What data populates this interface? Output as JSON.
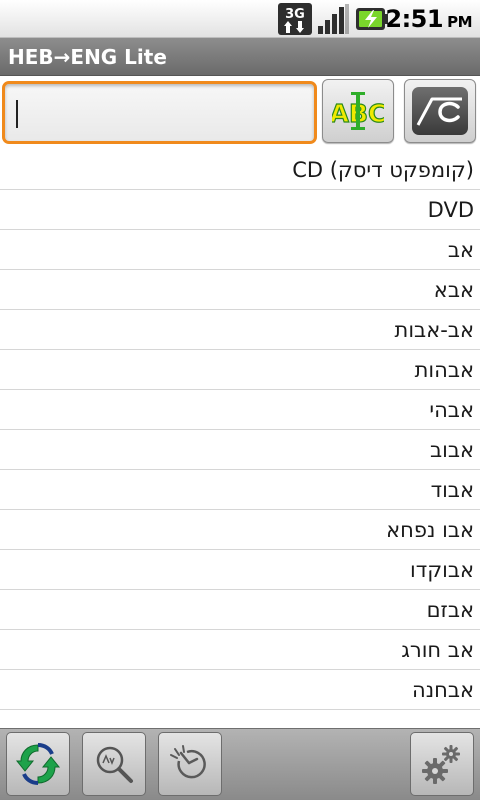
{
  "status_bar": {
    "network": "3G",
    "time": "2:51",
    "ampm": "PM"
  },
  "title_bar": {
    "title": "HEB→ENG Lite"
  },
  "search": {
    "value": "",
    "abc_label": "ABC"
  },
  "list": {
    "items": [
      "CD (קומפקט דיסק)",
      "DVD",
      "אב",
      "אבא",
      "אב-אבות",
      "אבהות",
      "אבהי",
      "אבוב",
      "אבוד",
      "אבו נפחא",
      "אבוקדו",
      "אבזם",
      "אב חורג",
      "אבחנה"
    ]
  },
  "bottom_bar": {
    "buttons": [
      {
        "icon": "swap-direction-icon"
      },
      {
        "icon": "dictionary-search-icon"
      },
      {
        "icon": "history-icon"
      },
      {
        "icon": "settings-gear-icon"
      }
    ]
  },
  "colors": {
    "accent_focus": "#f08a1c",
    "abc_letters": "#f0ea00",
    "abc_outline": "#2b8a1b",
    "title_bar": "#7a7a7a",
    "sync_green": "#1da24a"
  }
}
